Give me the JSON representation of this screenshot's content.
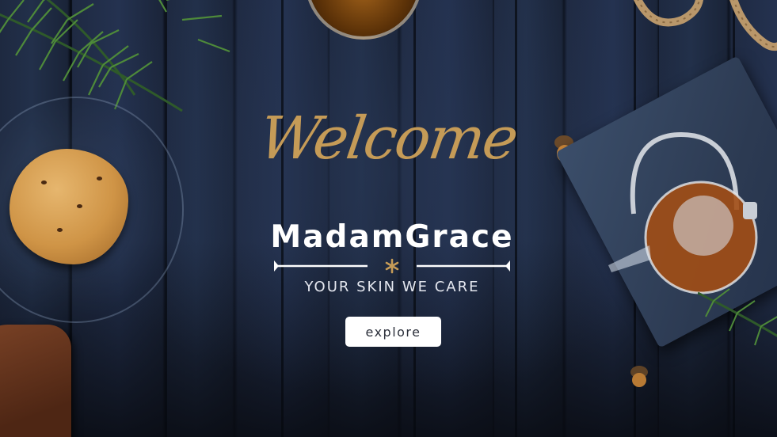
{
  "hero": {
    "welcome": "Welcome",
    "brand": "MadamGrace",
    "tagline": "YOUR SKIN WE CARE",
    "explore_label": "explore"
  },
  "colors": {
    "accent_gold": "#c59b57",
    "text_white": "#ffffff",
    "button_bg": "#ffffff",
    "background_navy": "#1b2336"
  },
  "icons": {
    "divider_ornament": "asterisk-icon"
  }
}
